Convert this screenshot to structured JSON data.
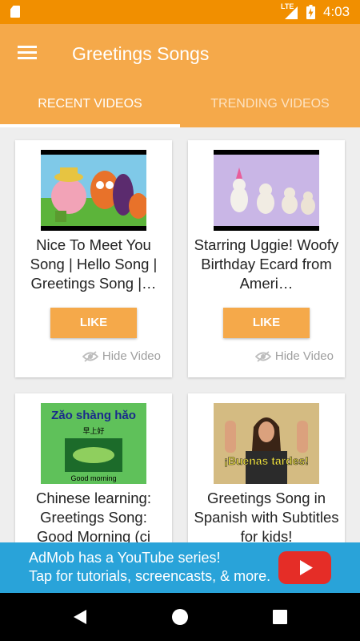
{
  "status_bar": {
    "network": "LTE",
    "time": "4:03",
    "icons": [
      "sd-card-icon",
      "signal-icon",
      "battery-charging-icon"
    ]
  },
  "app_bar": {
    "title": "Greetings Songs",
    "menu_icon": "hamburger-menu-icon"
  },
  "tabs": [
    {
      "label": "RECENT VIDEOS",
      "active": true
    },
    {
      "label": "TRENDING VIDEOS",
      "active": false
    }
  ],
  "videos": [
    {
      "title": "Nice To Meet You Song | Hello Song | Greetings Song |…",
      "like_label": "LIKE",
      "hide_label": "Hide Video"
    },
    {
      "title": "Starring Uggie! Woofy Birthday Ecard from Ameri…",
      "like_label": "LIKE",
      "hide_label": "Hide Video"
    },
    {
      "title": "Chinese learning: Greetings Song: Good Morning (ci",
      "thumb_text_top": "Zǎo shàng hǎo",
      "thumb_text_mid": "早上好",
      "thumb_text_bottom": "Good morning"
    },
    {
      "title": "Greetings Song in Spanish with Subtitles for kids!",
      "thumb_text": "¡Buenas tardes!"
    }
  ],
  "ad": {
    "line1": "AdMob has a YouTube series!",
    "line2": "Tap for tutorials, screencasts, & more.",
    "icon": "youtube-play-icon"
  },
  "colors": {
    "status_bar": "#f18f00",
    "app_bar": "#f5a94a",
    "like_button": "#f5a94a",
    "ad_background": "#29a3d9",
    "youtube_red": "#e52d27"
  }
}
